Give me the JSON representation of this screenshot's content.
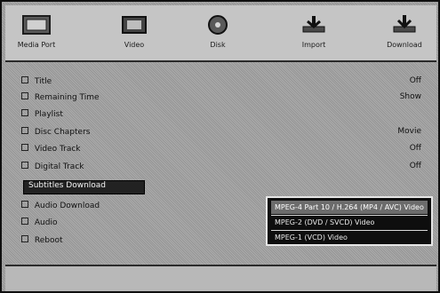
{
  "toolbar": {
    "items": [
      {
        "label": "Media Port"
      },
      {
        "label": "Video"
      },
      {
        "label": "Disk"
      },
      {
        "label": "Import"
      },
      {
        "label": "Download"
      }
    ]
  },
  "menu": {
    "items": [
      {
        "label": "Title",
        "value": "Off"
      },
      {
        "label": "Remaining Time",
        "value": "Show"
      },
      {
        "label": "Playlist"
      },
      {
        "label": "Disc Chapters",
        "value": "Movie"
      },
      {
        "label": "Video Track",
        "value": "Off"
      },
      {
        "label": "Digital Track",
        "value": "Off"
      },
      {
        "label": "Subtitles Download"
      },
      {
        "label": "Audio Download"
      },
      {
        "label": "Audio"
      },
      {
        "label": "Reboot"
      }
    ]
  },
  "popup": {
    "options": [
      {
        "label": "MPEG-4 Part 10 / H.264 (MP4 / AVC) Video"
      },
      {
        "label": "MPEG-2 (DVD / SVCD) Video"
      },
      {
        "label": "MPEG-1 (VCD) Video"
      }
    ],
    "selected_index": 0
  }
}
